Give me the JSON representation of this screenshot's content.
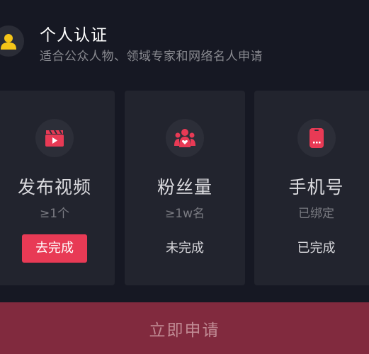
{
  "header": {
    "title": "个人认证",
    "subtitle": "适合公众人物、领域专家和网络名人申请",
    "icon": "person-icon"
  },
  "cards": [
    {
      "icon": "video-clapper-icon",
      "title": "发布视频",
      "requirement": "≥1个",
      "action": "去完成",
      "action_style": "primary"
    },
    {
      "icon": "fans-icon",
      "title": "粉丝量",
      "requirement": "≥1w名",
      "action": "未完成",
      "action_style": "plain"
    },
    {
      "icon": "phone-icon",
      "title": "手机号",
      "requirement": "已绑定",
      "action": "已完成",
      "action_style": "plain"
    }
  ],
  "apply_button": "立即申请",
  "colors": {
    "background": "#161823",
    "card": "#22242e",
    "accent": "#e83a55",
    "apply_bg": "#812a3e",
    "icon_yellow": "#f5c518"
  }
}
